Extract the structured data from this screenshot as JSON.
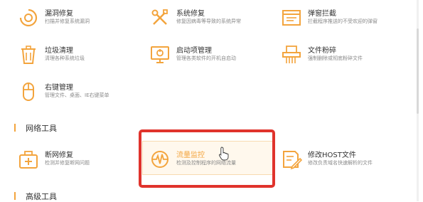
{
  "colors": {
    "accent": "#f3a43d",
    "highlight_border": "#e0332c"
  },
  "tools": [
    {
      "name": "漏洞修复",
      "desc": "扫描并修复系统漏洞",
      "icon": "shield-scan-icon"
    },
    {
      "name": "系统修复",
      "desc": "修复因病毒等导致的系统异常",
      "icon": "wrench-screwdriver-icon"
    },
    {
      "name": "弹窗拦截",
      "desc": "拦截程序推送的不受欢迎的弹窗",
      "icon": "popup-block-icon"
    },
    {
      "name": "垃圾清理",
      "desc": "清理各种系统垃圾",
      "icon": "trash-icon"
    },
    {
      "name": "启动项管理",
      "desc": "管理各类软件的开机自启动",
      "icon": "startup-monitor-icon"
    },
    {
      "name": "文件粉碎",
      "desc": "强制删除或彻底粉碎文件",
      "icon": "shredder-icon"
    },
    {
      "name": "右键管理",
      "desc": "管理文件、桌面、IE右键菜单",
      "icon": "mouse-icon"
    }
  ],
  "network_section": {
    "title": "网络工具"
  },
  "network_tools": [
    {
      "name": "断网修复",
      "desc": "检测并修复断网问题",
      "icon": "network-repair-kit-icon"
    },
    {
      "name": "流量监控",
      "desc": "检测及控制程序的网络流量",
      "icon": "traffic-monitor-icon"
    },
    {
      "name": "修改HOST文件",
      "desc": "修改负责域名快速解析的文件",
      "icon": "host-file-edit-icon"
    }
  ],
  "advanced_section": {
    "title": "高级工具"
  }
}
